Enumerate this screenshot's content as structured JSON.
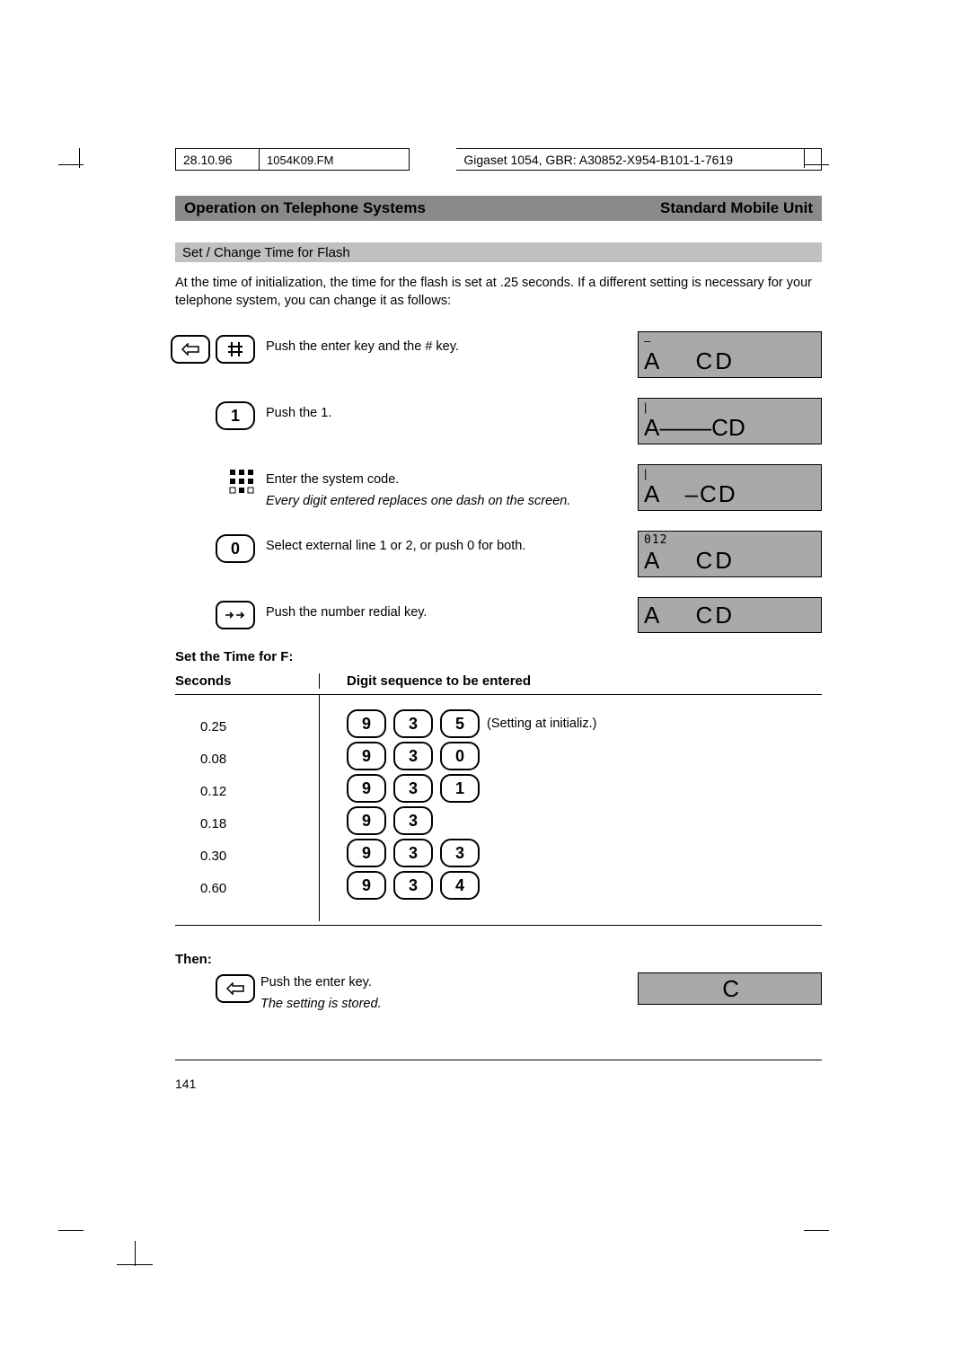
{
  "meta": {
    "date": "28.10.96",
    "file": "1054K09.FM",
    "ref": "Gigaset 1054, GBR: A30852-X954-B101-1-7619"
  },
  "title": {
    "left": "Operation on Telephone Systems",
    "right": "Standard Mobile Unit"
  },
  "section": "Set / Change Time for Flash",
  "intro": "At the time of initialization, the time for the flash is set at .25 seconds. If a different setting is necessary for your telephone system, you can change it as follows:",
  "steps": {
    "s1": {
      "text": "Push the enter key and the # key.",
      "screenTop": "–",
      "screenA": "A",
      "screenCD": "CD"
    },
    "s2": {
      "keyLabel": "1",
      "text": "Push the 1.",
      "screenTop": "|",
      "screenLine": "A––––CD"
    },
    "s3": {
      "text": "Enter the system code.",
      "note": "Every digit entered replaces one dash on the screen.",
      "screenTop": "|",
      "screenLine": "A   –CD"
    },
    "s4": {
      "keyLabel": "0",
      "text": "Select external line 1 or 2, or push 0 for both.",
      "screenTop": "012",
      "screenA": "A",
      "screenCD": "CD"
    },
    "s5": {
      "text": "Push the number redial key.",
      "screenA": "A",
      "screenCD": "CD"
    }
  },
  "setTimeHeading": "Set the Time for F:",
  "tableHeaders": {
    "col1": "Seconds",
    "col2": "Digit sequence to be entered"
  },
  "chart_data": {
    "type": "table",
    "title": "Set the Time for F",
    "columns": [
      "Seconds",
      "Digit sequence to be entered"
    ],
    "rows": [
      {
        "seconds": "0.25",
        "digits": [
          "9",
          "3",
          "5"
        ],
        "note": "(Setting at initializ.)"
      },
      {
        "seconds": "0.08",
        "digits": [
          "9",
          "3",
          "0"
        ],
        "note": ""
      },
      {
        "seconds": "0.12",
        "digits": [
          "9",
          "3",
          "1"
        ],
        "note": ""
      },
      {
        "seconds": "0.18",
        "digits": [
          "9",
          "3"
        ],
        "note": ""
      },
      {
        "seconds": "0.30",
        "digits": [
          "9",
          "3",
          "3"
        ],
        "note": ""
      },
      {
        "seconds": "0.60",
        "digits": [
          "9",
          "3",
          "4"
        ],
        "note": ""
      }
    ]
  },
  "then": {
    "label": "Then:",
    "text": "Push the enter key.",
    "note": "The setting is stored.",
    "screen": "C"
  },
  "pageNumber": "141"
}
